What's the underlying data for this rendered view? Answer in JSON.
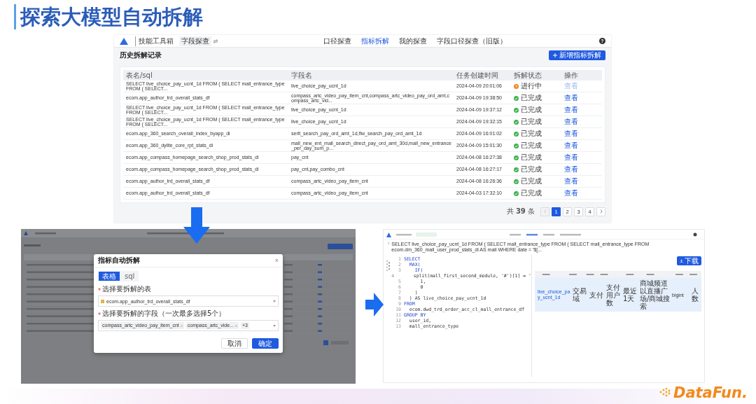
{
  "title": "探索大模型自动拆解",
  "main_screenshot": {
    "nav": {
      "toolbox": "技能工具箱",
      "workspace": "字段探查",
      "tabs": [
        {
          "label": "口径探查",
          "selected": false
        },
        {
          "label": "指标拆解",
          "selected": true
        },
        {
          "label": "我的探查",
          "selected": false
        },
        {
          "label": "字段口径探查（旧版）",
          "selected": false
        }
      ],
      "help": "?"
    },
    "heading": "历史拆解记录",
    "new_button": "新增指标拆解",
    "table": {
      "columns": [
        "表名/sql",
        "字段名",
        "任务创建时间",
        "拆解状态",
        "操作"
      ],
      "rows": [
        {
          "table": "SELECT live_choice_pay_ucnt_1d FROM ( SELECT mall_entrance_type FROM ( SELECT...",
          "fields": "live_choice_pay_ucnt_1d",
          "created": "2024-04-09 20:01:06",
          "status": "进行中",
          "done": false,
          "color": "#f08a24",
          "action": "查看",
          "disabled": true
        },
        {
          "table": "ecom.app_author_trd_overall_stats_df",
          "fields": "compass_artc_video_pay_item_cnt,compass_artc_video_pay_ord_amt,compass_artc_vid...",
          "created": "2024-04-09 19:38:50",
          "status": "已完成",
          "done": true,
          "color": "#3fb14f",
          "action": "查看",
          "disabled": false
        },
        {
          "table": "SELECT live_choice_pay_ucnt_1d FROM ( SELECT mall_entrance_type FROM ( SELECT...",
          "fields": "live_choice_pay_ucnt_1d",
          "created": "2024-04-09 19:37:12",
          "status": "已完成",
          "done": true,
          "color": "#3fb14f",
          "action": "查看",
          "disabled": false
        },
        {
          "table": "SELECT live_choice_pay_ucnt_1d FROM ( SELECT mall_entrance_type FROM ( SELECT...",
          "fields": "live_choice_pay_ucnt_1d",
          "created": "2024-04-09 19:32:15",
          "status": "已完成",
          "done": true,
          "color": "#3fb14f",
          "action": "查看",
          "disabled": false
        },
        {
          "table": "ecom.app_360_search_overall_index_byapp_di",
          "fields": "serlt_search_pay_ord_amt_1d,flw_search_pay_ord_amt_1d",
          "created": "2024-04-09 16:01:02",
          "status": "已完成",
          "done": true,
          "color": "#3fb14f",
          "action": "查看",
          "disabled": false
        },
        {
          "table": "ecom.app_360_dylite_core_rpt_stats_di",
          "fields": "mall_new_ent_mall_search_direct_pay_ord_amt_30d,mall_new_entrance_per_day_sum_p...",
          "created": "2024-04-09 15:01:30",
          "status": "已完成",
          "done": true,
          "color": "#3fb14f",
          "action": "查看",
          "disabled": false
        },
        {
          "table": "ecom.app_compass_homepage_search_shop_prod_stats_di",
          "fields": "pay_cnt",
          "created": "2024-04-08 16:27:38",
          "status": "已完成",
          "done": true,
          "color": "#3fb14f",
          "action": "查看",
          "disabled": false
        },
        {
          "table": "ecom.app_compass_homepage_search_shop_prod_stats_di",
          "fields": "pay_cnt,pay_combo_cnt",
          "created": "2024-04-08 16:27:17",
          "status": "已完成",
          "done": true,
          "color": "#3fb14f",
          "action": "查看",
          "disabled": false
        },
        {
          "table": "ecom.app_author_trd_overall_stats_df",
          "fields": "compass_artc_video_pay_item_cnt",
          "created": "2024-04-08 16:26:36",
          "status": "已完成",
          "done": true,
          "color": "#3fb14f",
          "action": "查看",
          "disabled": false
        },
        {
          "table": "ecom.app_author_trd_overall_stats_df",
          "fields": "compass_artc_video_pay_item_cnt",
          "created": "2024-04-03 17:32:10",
          "status": "已完成",
          "done": true,
          "color": "#3fb14f",
          "action": "查看",
          "disabled": false
        }
      ]
    },
    "pagination": {
      "total": "共 **39** 条",
      "pages": [
        {
          "label": "1",
          "selected": true
        },
        {
          "label": "2",
          "selected": false
        },
        {
          "label": "3",
          "selected": false
        },
        {
          "label": "4",
          "selected": false
        }
      ]
    }
  },
  "dialog_screenshot": {
    "dialog": {
      "title": "指标自动拆解",
      "close": "×",
      "tabs": [
        {
          "label": "表格",
          "selected": true
        },
        {
          "label": "sql",
          "selected": false
        }
      ],
      "fields": [
        {
          "label": "选择要拆解的表",
          "required": true,
          "kind": "select",
          "value": "ecom.app_author_trd_overall_stats_df"
        },
        {
          "label": "选择要拆解的字段（一次最多选择5个）",
          "required": true,
          "kind": "tags",
          "tags": [
            "compass_artc_video_pay_item_cnt",
            "compass_artc_vide..."
          ],
          "more": "+3"
        }
      ],
      "buttons": [
        {
          "label": "取消",
          "kind": "secondary"
        },
        {
          "label": "确定",
          "kind": "primary"
        }
      ]
    }
  },
  "result_screenshot": {
    "sql_path": "SELECT live_choice_pay_ucnt_1d FROM ( SELECT mall_entrance_type FROM ( SELECT mall_entrance_type FROM ecom.dm_360_mall_user_prod_stats_di AS mall WHERE date = '$[...",
    "code": [
      {
        "n": "1",
        "text": "SELECT",
        "keyword": true
      },
      {
        "n": "2",
        "text": "  MAX(",
        "keyword": true
      },
      {
        "n": "3",
        "text": "    IF(",
        "keyword": true
      },
      {
        "n": "4",
        "text": "      split(mall_first_second_module, '#')[1] = '",
        "keyword": false
      },
      {
        "n": "5",
        "text": "      1,",
        "keyword": false
      },
      {
        "n": "6",
        "text": "      0",
        "keyword": false
      },
      {
        "n": "7",
        "text": "    )",
        "keyword": false
      },
      {
        "n": "8",
        "text": "  ) AS live_choice_pay_ucnt_1d",
        "keyword": false
      },
      {
        "n": "9",
        "text": "FROM",
        "keyword": true
      },
      {
        "n": "10",
        "text": "  ecom.dwd_trd_order_acc_cl_mall_entrance_df",
        "keyword": false
      },
      {
        "n": "11",
        "text": "GROUP BY",
        "keyword": true
      },
      {
        "n": "12",
        "text": "  user_id,",
        "keyword": false
      },
      {
        "n": "13",
        "text": "  mall_entrance_type",
        "keyword": false
      }
    ],
    "download_button": "下载",
    "row": {
      "selected": true,
      "cells": [
        "live_choice_pay_ucnt_1d",
        "交易域",
        "支付",
        "支付用户数",
        "最近1天",
        "商城频道以直播广场/商城搜索",
        "bigint",
        "人数"
      ]
    }
  },
  "logo": "DataFun."
}
